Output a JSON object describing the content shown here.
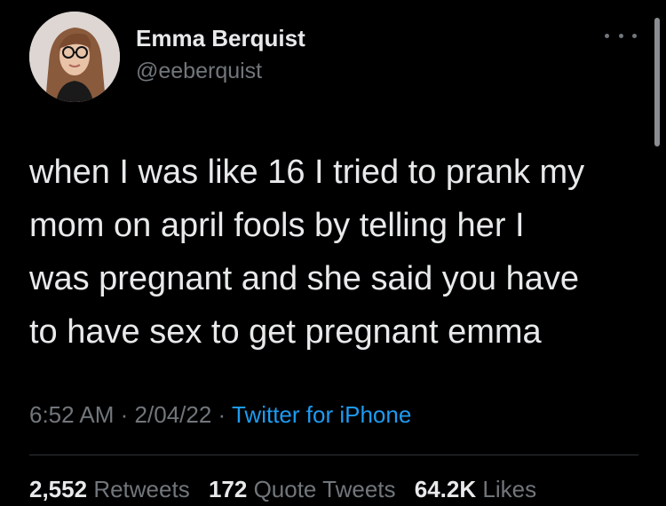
{
  "author": {
    "name": "Emma Berquist",
    "handle": "@eeberquist"
  },
  "tweet": {
    "lines": [
      "when I was like 16 I tried to prank my",
      "mom on april fools by telling her I",
      "was pregnant and she said you have",
      "to have sex to get pregnant emma"
    ],
    "time": "6:52 AM",
    "separator": "·",
    "date": "2/04/22",
    "source": "Twitter for iPhone"
  },
  "stats": {
    "retweets_count": "2,552",
    "retweets_label": "Retweets",
    "quotes_count": "172",
    "quotes_label": "Quote Tweets",
    "likes_count": "64.2K",
    "likes_label": "Likes"
  },
  "icons": {
    "more": "more-horizontal-icon"
  },
  "colors": {
    "background": "#000000",
    "primary_text": "#e7e9ea",
    "secondary_text": "#71767b",
    "link": "#1d9bf0",
    "divider": "#2f3336"
  }
}
